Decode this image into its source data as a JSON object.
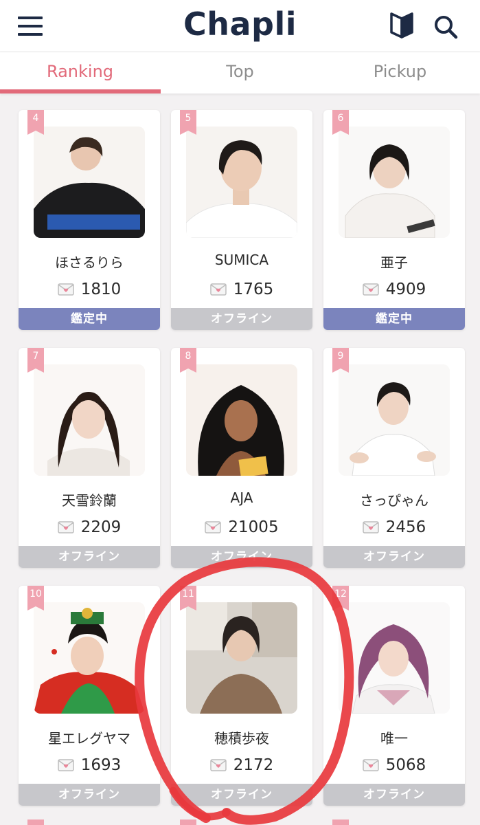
{
  "header": {
    "logo": "Chapli",
    "menu_icon": "hamburger-menu-icon",
    "beginner_icon": "beginner-mark-icon",
    "search_icon": "search-icon"
  },
  "tabs": [
    {
      "label": "Ranking",
      "active": true
    },
    {
      "label": "Top",
      "active": false
    },
    {
      "label": "Pickup",
      "active": false
    }
  ],
  "colors": {
    "accent": "#e26a7a",
    "brand_text": "#1d2a44",
    "status_busy": "#7b84bd",
    "status_offline": "#c7c7cb",
    "annotation_circle": "#e8383d"
  },
  "cards": [
    {
      "rank": "4",
      "name": "ほさるりら",
      "count": "1810",
      "status": "鑑定中"
    },
    {
      "rank": "5",
      "name": "SUMICA",
      "count": "1765",
      "status": "オフライン"
    },
    {
      "rank": "6",
      "name": "亜子",
      "count": "4909",
      "status": "鑑定中"
    },
    {
      "rank": "7",
      "name": "天雪鈴蘭",
      "count": "2209",
      "status": "オフライン"
    },
    {
      "rank": "8",
      "name": "AJA",
      "count": "21005",
      "status": "オフライン"
    },
    {
      "rank": "9",
      "name": "さっぴゃん",
      "count": "2456",
      "status": "オフライン"
    },
    {
      "rank": "10",
      "name": "星エレグヤマ",
      "count": "1693",
      "status": "オフライン"
    },
    {
      "rank": "11",
      "name": "穂積歩夜",
      "count": "2172",
      "status": "オフライン"
    },
    {
      "rank": "12",
      "name": "唯一",
      "count": "5068",
      "status": "オフライン"
    }
  ]
}
